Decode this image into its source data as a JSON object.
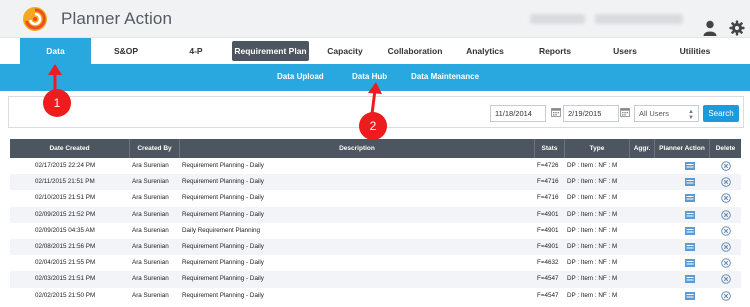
{
  "header": {
    "app_title": "Planner Action",
    "logo_icon": "swirl-logo",
    "user_icon": "user-icon",
    "settings_icon": "gear-icon",
    "colors": {
      "bg": "#f1f2f4",
      "title": "#555b63"
    }
  },
  "mainnav": {
    "items": [
      {
        "label": "Data",
        "state": "active"
      },
      {
        "label": "S&OP"
      },
      {
        "label": "4-P"
      },
      {
        "label": "Requirement Plan",
        "state": "highlighted"
      },
      {
        "label": "Capacity"
      },
      {
        "label": "Collaboration"
      },
      {
        "label": "Analytics"
      },
      {
        "label": "Reports"
      },
      {
        "label": "Users"
      },
      {
        "label": "Utilities"
      }
    ],
    "active_color": "#29a8e0",
    "highlight_color": "#4d5660"
  },
  "subnav": {
    "items": [
      {
        "label": "Data Upload"
      },
      {
        "label": "Data Hub"
      },
      {
        "label": "Data Maintenance"
      }
    ],
    "color": "#29a8e0"
  },
  "filters": {
    "start_date": "11/18/2014",
    "end_date": "2/19/2015",
    "user_select": "All Users",
    "search_label": "Search",
    "search_color": "#1a9be0"
  },
  "table": {
    "headers": [
      "Date Created",
      "Created By",
      "Description",
      "Stats",
      "Type",
      "Aggr.",
      "Planner Action",
      "Delete"
    ],
    "header_color": "#4d5660",
    "rows": [
      [
        "02/17/2015 22:24 PM",
        "Ara Surenian",
        "Requirement Planning - Daily",
        "F=4726",
        "DP : Item : NF : M"
      ],
      [
        "02/11/2015 21:51 PM",
        "Ara Surenian",
        "Requirement Planning - Daily",
        "F=4716",
        "DP : Item : NF : M"
      ],
      [
        "02/10/2015 21:51 PM",
        "Ara Surenian",
        "Requirement Planning - Daily",
        "F=4716",
        "DP : Item : NF : M"
      ],
      [
        "02/09/2015 21:52 PM",
        "Ara Surenian",
        "Requirement Planning - Daily",
        "F=4901",
        "DP : Item : NF : M"
      ],
      [
        "02/09/2015 04:35 AM",
        "Ara Surenian",
        "Daily Requirement Planning",
        "F=4901",
        "DP : Item : NF : M"
      ],
      [
        "02/08/2015 21:56 PM",
        "Ara Surenian",
        "Requirement Planning - Daily",
        "F=4901",
        "DP : Item : NF : M"
      ],
      [
        "02/04/2015 21:55 PM",
        "Ara Surenian",
        "Requirement Planning - Daily",
        "F=4632",
        "DP : Item : NF : M"
      ],
      [
        "02/03/2015 21:51 PM",
        "Ara Surenian",
        "Requirement Planning - Daily",
        "F=4547",
        "DP : Item : NF : M"
      ],
      [
        "02/02/2015 21:50 PM",
        "Ara Surenian",
        "Requirement Planning - Daily",
        "F=4547",
        "DP : Item : NF : M"
      ]
    ]
  },
  "annotations": [
    {
      "label": "1",
      "color": "#ee1c1c"
    },
    {
      "label": "2",
      "color": "#ee1c1c"
    }
  ]
}
